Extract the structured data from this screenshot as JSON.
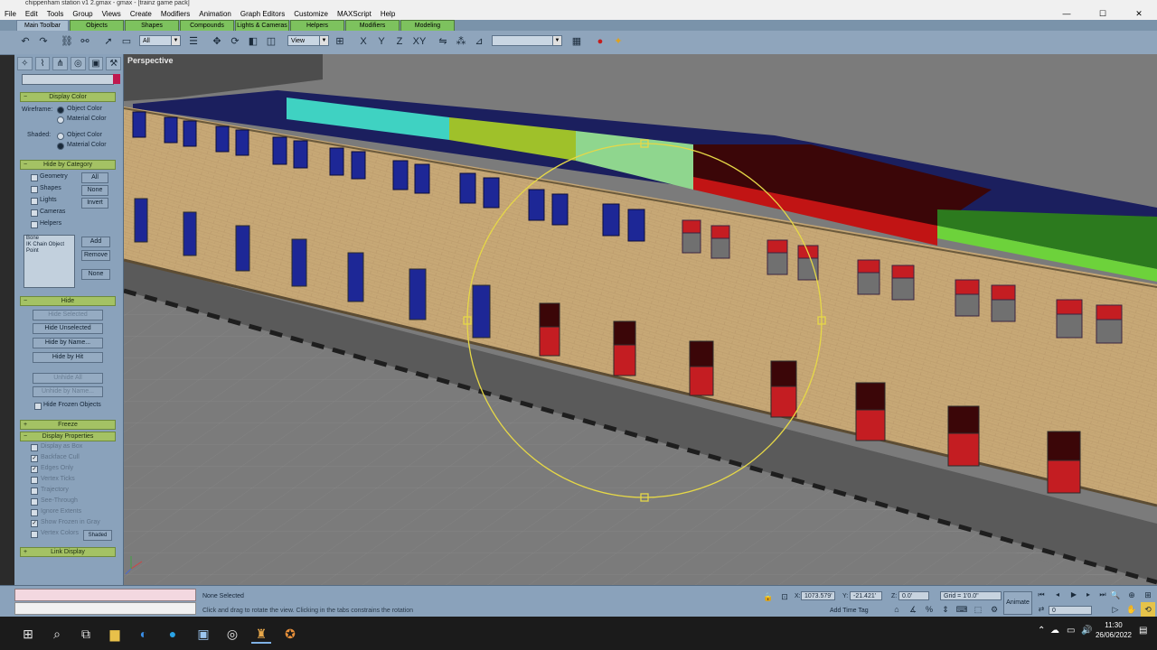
{
  "window": {
    "title": "chippenham station v1 2.gmax - gmax - [trainz game pack]",
    "controls": [
      "—",
      "☐",
      "✕"
    ]
  },
  "menu": [
    "File",
    "Edit",
    "Tools",
    "Group",
    "Views",
    "Create",
    "Modifiers",
    "Animation",
    "Graph Editors",
    "Customize",
    "MAXScript",
    "Help"
  ],
  "tabs": [
    "Main Toolbar",
    "Objects",
    "Shapes",
    "Compounds",
    "Lights & Cameras",
    "Helpers",
    "Modifiers",
    "Modeling"
  ],
  "toolbar": {
    "selection_filter": "All",
    "reference_coord": "View",
    "named_selection": ""
  },
  "panel": {
    "display_color": {
      "title": "Display Color",
      "wireframe_label": "Wireframe:",
      "shaded_label": "Shaded:",
      "object_color": "Object Color",
      "material_color": "Material Color"
    },
    "hide_by_category": {
      "title": "Hide by Category",
      "items": [
        "Geometry",
        "Shapes",
        "Lights",
        "Cameras",
        "Helpers"
      ],
      "buttons": [
        "All",
        "None",
        "Invert"
      ],
      "list": [
        "Bone",
        "IK Chain Object",
        "Point"
      ],
      "list_buttons": [
        "Add",
        "Remove",
        "None"
      ]
    },
    "hide": {
      "title": "Hide",
      "buttons": [
        "Hide Selected",
        "Hide Unselected",
        "Hide by Name...",
        "Hide by Hit",
        "Unhide All",
        "Unhide by Name..."
      ],
      "frozen": "Hide Frozen Objects"
    },
    "freeze": {
      "title": "Freeze"
    },
    "display_properties": {
      "title": "Display Properties",
      "items": [
        "Display as Box",
        "Backface Cull",
        "Edges Only",
        "Vertex Ticks",
        "Trajectory",
        "See-Through",
        "Ignore Extents",
        "Show Frozen in Gray",
        "Vertex Colors"
      ],
      "checked": [
        false,
        true,
        true,
        false,
        false,
        false,
        false,
        true,
        false
      ],
      "shaded_btn": "Shaded"
    },
    "link_display": {
      "title": "Link Display"
    }
  },
  "viewport": {
    "label": "Perspective"
  },
  "status": {
    "selection": "None Selected",
    "prompt": "Click and drag to rotate the view.  Clicking in the tabs constrains the rotation",
    "x_label": "X:",
    "x_value": "1073.579'",
    "y_label": "Y:",
    "y_value": "-21.421'",
    "z_label": "Z:",
    "z_value": "0.0'",
    "grid": "Grid = 1'0.0\"",
    "add_time_tag": "Add Time Tag",
    "animate": "Animate",
    "frame": "0"
  },
  "taskbar": {
    "time": "11:30",
    "date": "26/06/2022"
  }
}
